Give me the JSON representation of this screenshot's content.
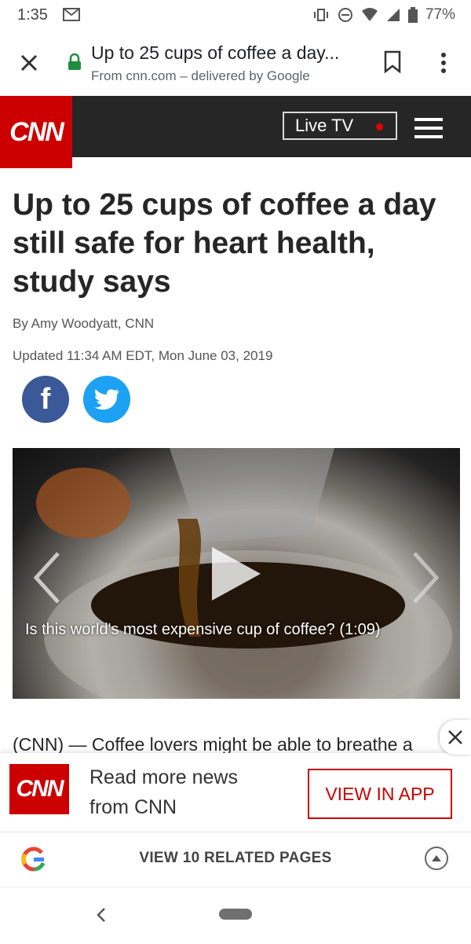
{
  "status_bar": {
    "time": "1:35",
    "battery": "77%"
  },
  "amp_header": {
    "title": "Up to 25 cups of coffee a day...",
    "subtitle": "From cnn.com – delivered by Google"
  },
  "cnn_bar": {
    "logo_text": "CNN",
    "live_tv_label": "Live TV"
  },
  "article": {
    "headline": "Up to 25 cups of coffee a day still safe for heart health, study says",
    "byline": "By Amy Woodyatt, CNN",
    "updated": "Updated 11:34 AM EDT, Mon June 03, 2019",
    "video_caption": "Is this world's most expensive cup of coffee? (1:09)",
    "body_start": "(CNN) — Coffee lovers might be able to breathe a"
  },
  "promo": {
    "logo_text": "CNN",
    "text": "Read more news from CNN",
    "button_label": "VIEW IN APP"
  },
  "related": {
    "label": "VIEW 10 RELATED PAGES"
  },
  "colors": {
    "cnn_red": "#cc0000",
    "bar_dark": "#262626",
    "facebook": "#3b5998",
    "twitter": "#1da1f2"
  }
}
